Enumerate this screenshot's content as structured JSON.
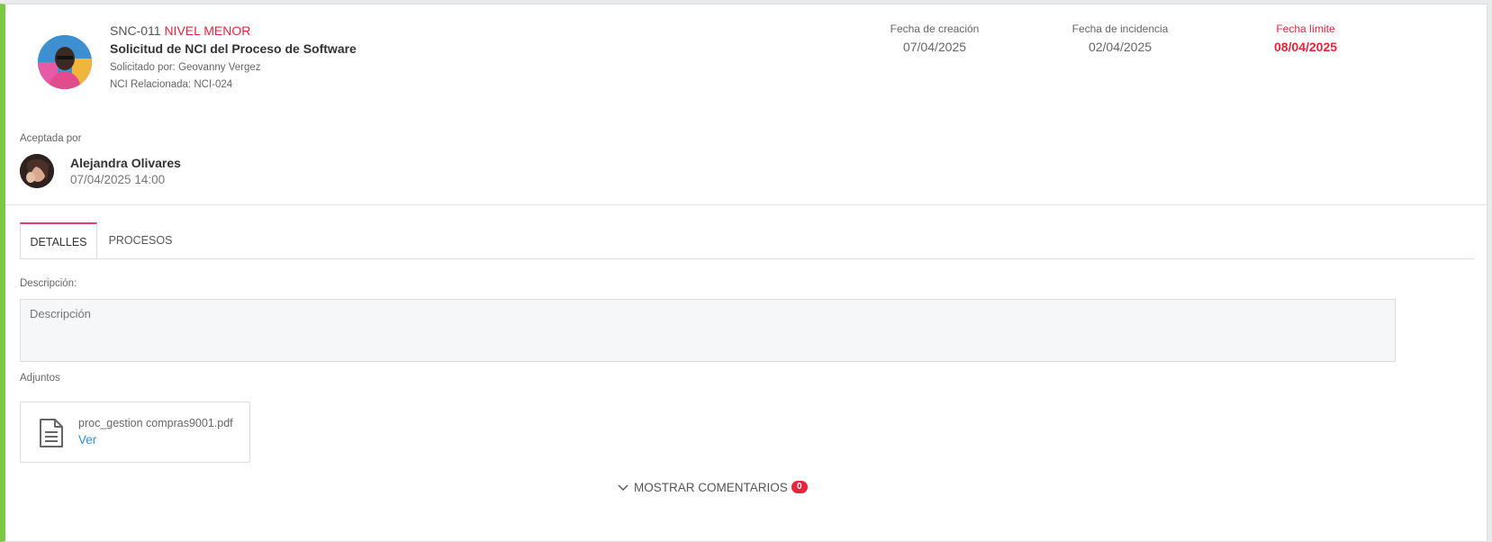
{
  "request": {
    "code": "SNC-011",
    "level": "NIVEL MENOR",
    "subject": "Solicitud de NCI del Proceso de Software",
    "requested_by": "Solicitado por: Geovanny Vergez",
    "related": "NCI Relacionada: NCI-024"
  },
  "dates": {
    "creation_label": "Fecha de creación",
    "creation_value": "07/04/2025",
    "incident_label": "Fecha de incidencia",
    "incident_value": "02/04/2025",
    "limit_label": "Fecha límite",
    "limit_value": "08/04/2025"
  },
  "accepted": {
    "label": "Aceptada por",
    "name": "Alejandra Olivares",
    "datetime": "07/04/2025 14:00"
  },
  "tabs": [
    {
      "label": "DETALLES",
      "active": true
    },
    {
      "label": "PROCESOS",
      "active": false
    }
  ],
  "details": {
    "description_label": "Descripción:",
    "description_placeholder": "Descripción",
    "description_value": "",
    "attachments_label": "Adjuntos",
    "attachment": {
      "file_name": "proc_gestion compras9001.pdf",
      "link_label": "Ver",
      "icon": "document-icon"
    }
  },
  "comments": {
    "label": "MOSTRAR COMENTARIOS",
    "count": "0",
    "icon": "chevron-down-icon"
  },
  "colors": {
    "accent_bar": "#7ac943",
    "alert": "#e8243c",
    "active_tab": "#e23a7a",
    "link": "#2f8fe0"
  }
}
